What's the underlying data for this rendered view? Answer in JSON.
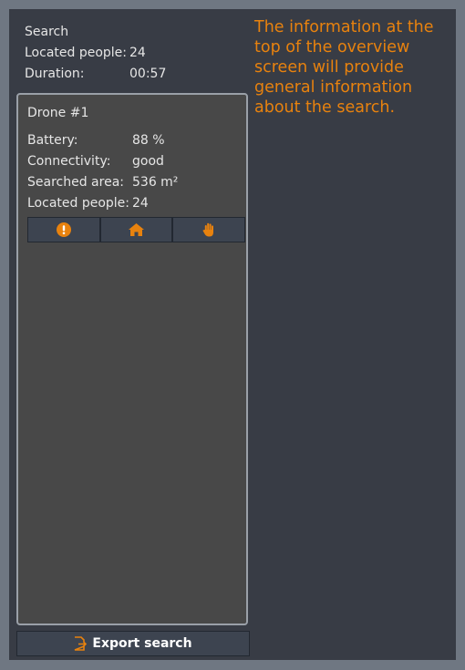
{
  "summary": {
    "title": "Search",
    "located_label": "Located people:",
    "located_value": "24",
    "duration_label": "Duration:",
    "duration_value": "00:57"
  },
  "tooltip": {
    "text": "The information at the top of the overview screen will provide general information about the search."
  },
  "drone": {
    "name": "Drone #1",
    "stats": [
      {
        "label": "Battery:",
        "value": "88 %"
      },
      {
        "label": "Connectivity:",
        "value": "good"
      },
      {
        "label": "Searched area:",
        "value": "536 m²"
      },
      {
        "label": "Located people:",
        "value": "24"
      }
    ],
    "actions": [
      {
        "icon": "alert-icon"
      },
      {
        "icon": "home-icon"
      },
      {
        "icon": "stop-hand-icon"
      }
    ]
  },
  "export": {
    "label": "Export search",
    "icon": "export-file-icon"
  },
  "colors": {
    "accent": "#e8820e",
    "panel": "#383c45",
    "card": "#484848",
    "button": "#3d4450",
    "outer": "#6f7782"
  }
}
